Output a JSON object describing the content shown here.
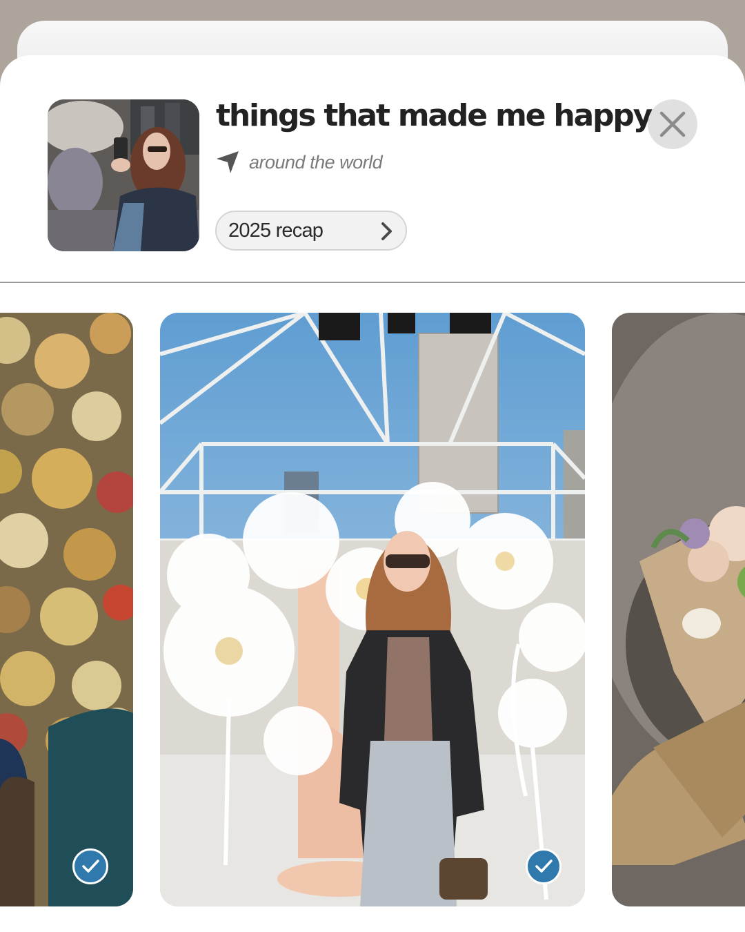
{
  "collection": {
    "title": "things that made me happy",
    "subtitle": "around the world",
    "recap_label": "2025 recap"
  },
  "icons": {
    "location": "location-arrow-icon",
    "recap": "chevron-right-icon",
    "close": "close-x-icon",
    "selected": "checkmark-icon"
  },
  "photos": [
    {
      "name": "autumn-leaves-photo",
      "selected": true
    },
    {
      "name": "flower-installation-portrait-photo",
      "selected": true
    },
    {
      "name": "flower-bouquet-photo",
      "selected": false
    }
  ],
  "colors": {
    "backdrop": "#ada49c",
    "sheet": "#ffffff",
    "selected_badge": "#2f79ad",
    "title_text": "#222222",
    "subtitle_text": "#7a7a7a"
  }
}
